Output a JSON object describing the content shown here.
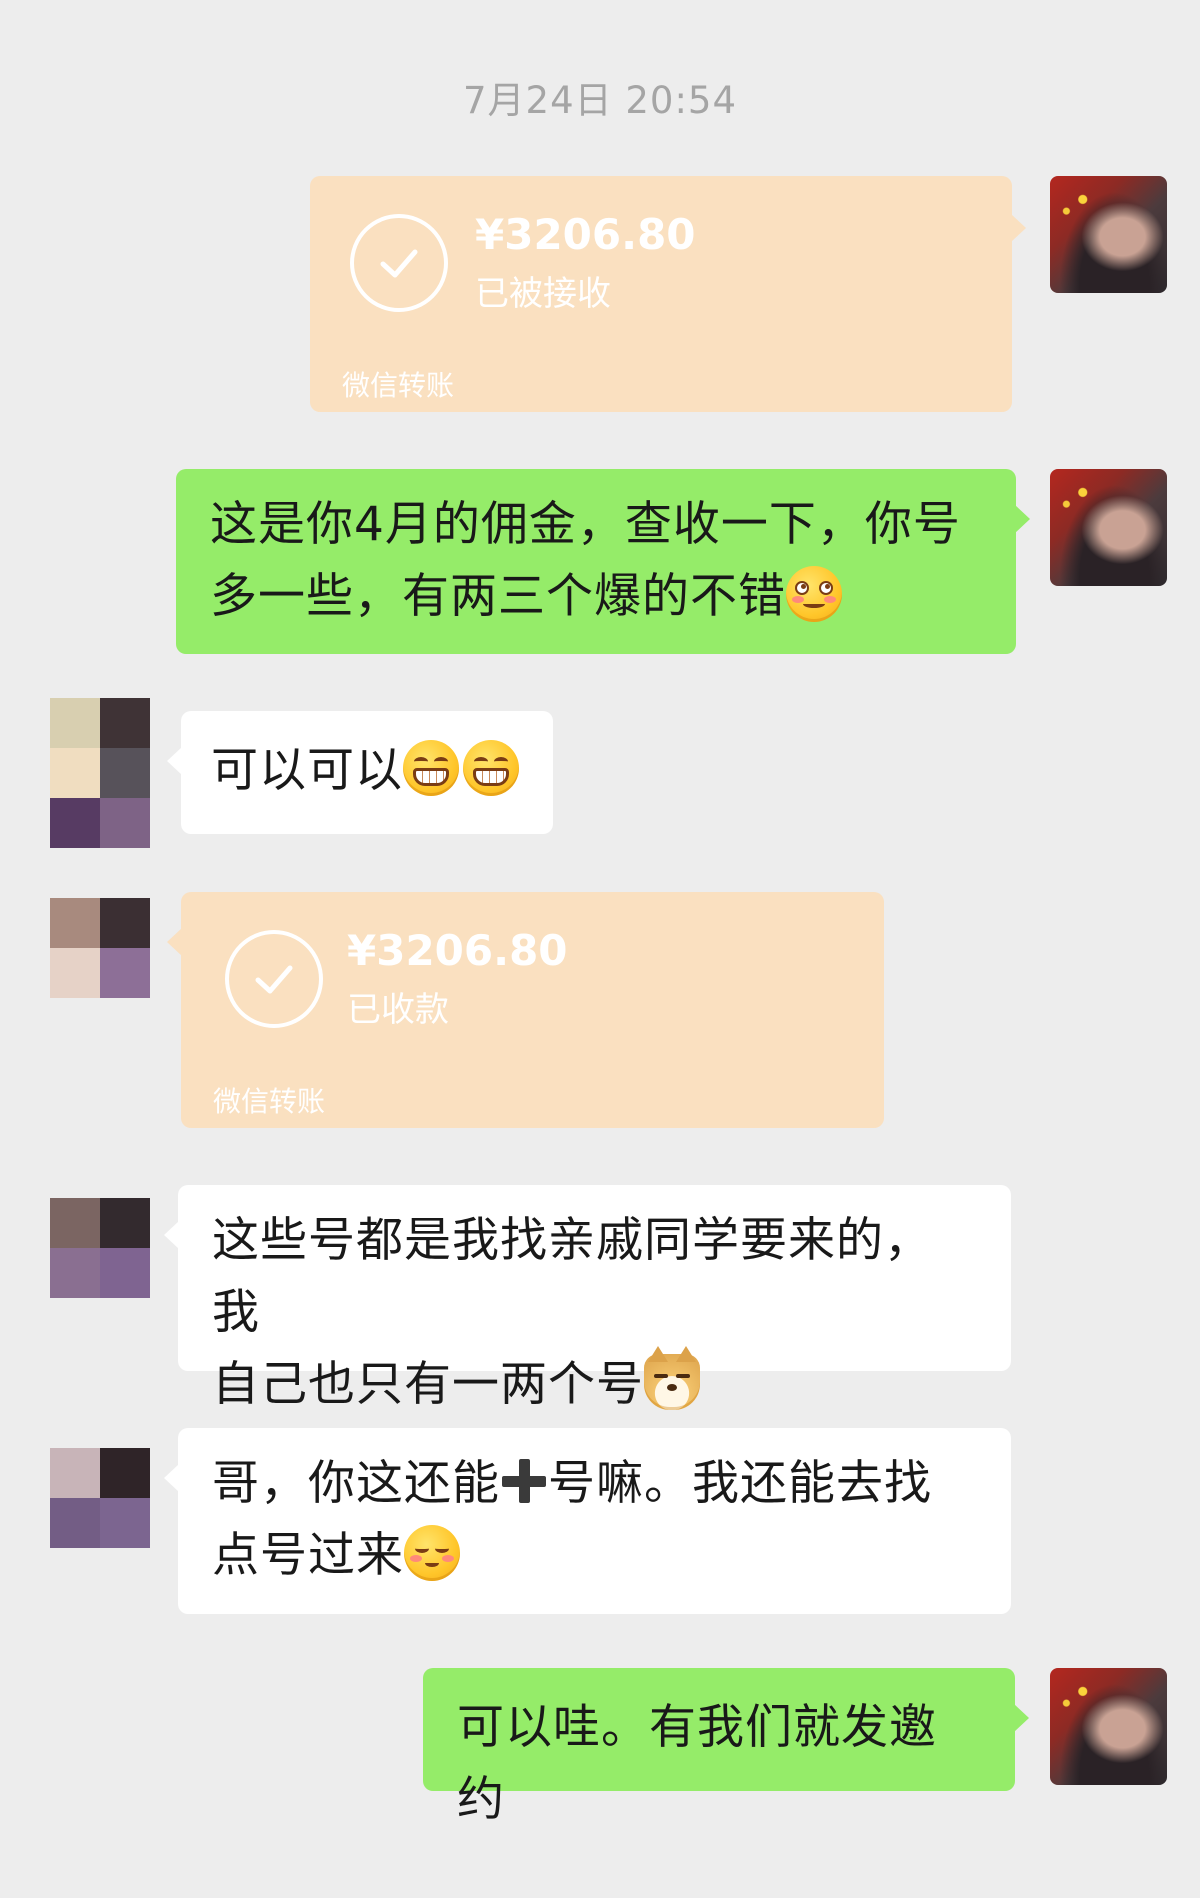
{
  "chat": {
    "timestamp": "7月24日 20:54",
    "transfer_sent": {
      "amount": "¥3206.80",
      "status": "已被接收",
      "brand": "微信转账"
    },
    "msg_commission_line1": "这是你4月的佣金，查收一下，你号",
    "msg_commission_line2": "多一些，有两三个爆的不错",
    "msg_reply_ok": "可以可以",
    "transfer_received": {
      "amount": "¥3206.80",
      "status": "已收款",
      "brand": "微信转账"
    },
    "msg_accounts_line1": "这些号都是我找亲戚同学要来的，我",
    "msg_accounts_line2": "自己也只有一两个号",
    "msg_question_part1": "哥，你这还能",
    "msg_question_part2": "号嘛。我还能去找",
    "msg_question_line2": "点号过来",
    "msg_final": "可以哇。有我们就发邀约"
  },
  "colors": {
    "background": "#ededed",
    "self_bubble": "#95ec69",
    "other_bubble": "#ffffff",
    "transfer_card": "#fae0c0",
    "timestamp_text": "#a5a5a5"
  },
  "icons": {
    "transfer_status": "check-circle-icon",
    "emoji_smirk": "smirk-emoji-icon",
    "emoji_grin": "grin-emoji-icon",
    "emoji_doge": "doge-emoji-icon",
    "emoji_shy": "shy-emoji-icon",
    "plus": "plus-icon"
  }
}
